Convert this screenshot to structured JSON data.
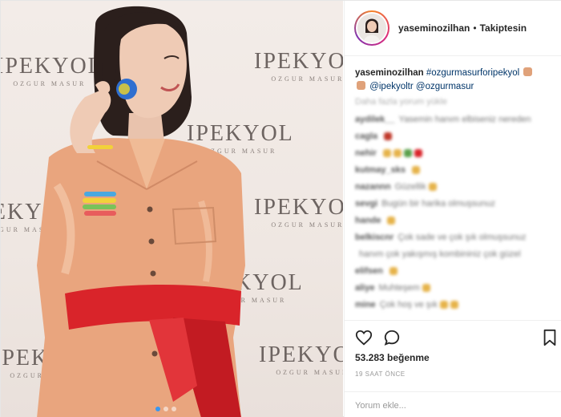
{
  "post": {
    "username": "yaseminozilhan",
    "separator": "•",
    "follow_status": "Takiptesin"
  },
  "photo": {
    "backdrop_brand": "IPEKYOL",
    "backdrop_sub": "OZGUR MASUR"
  },
  "caption": {
    "username": "yaseminozilhan",
    "hashtag": "#ozgurmasurforipekyol",
    "mention1": "@ipekyoltr",
    "mention2": "@ozgurmasur"
  },
  "comments_section": {
    "view_all": "Daha fazla yorum yükle",
    "comments": [
      {
        "user": "aydilek__",
        "text": "Yasemin hanım elbiseniz nereden"
      },
      {
        "user": "cagla",
        "text": ""
      },
      {
        "user": "nehir",
        "text": ""
      },
      {
        "user": "kutmay_sks",
        "text": ""
      },
      {
        "user": "nazannn",
        "text": "Güzellik"
      },
      {
        "user": "sevgi",
        "text": "Bugün bir harika olmuşsunuz"
      },
      {
        "user": "hande",
        "text": ""
      },
      {
        "user": "belkiscnr",
        "text": "Çok sade ve çok şık olmuşsunuz"
      },
      {
        "user": "",
        "text": "hanım çok yakışmış kombininiz çok güzel"
      },
      {
        "user": "elifsen",
        "text": ""
      },
      {
        "user": "aliye",
        "text": "Muhteşem"
      },
      {
        "user": "mine",
        "text": "Çok hoş ve şık"
      }
    ]
  },
  "actions": {
    "likes": "53.283 beğenme",
    "timestamp": "19 SAAT ÖNCE"
  },
  "comment_box": {
    "placeholder": "Yorum ekle..."
  },
  "colors": {
    "accent_link": "#003569",
    "text": "#262626",
    "muted": "#999999",
    "blouse": "#e9a57e",
    "sash": "#d9242a"
  },
  "icons": [
    "heart-icon",
    "comment-icon",
    "bookmark-icon"
  ]
}
